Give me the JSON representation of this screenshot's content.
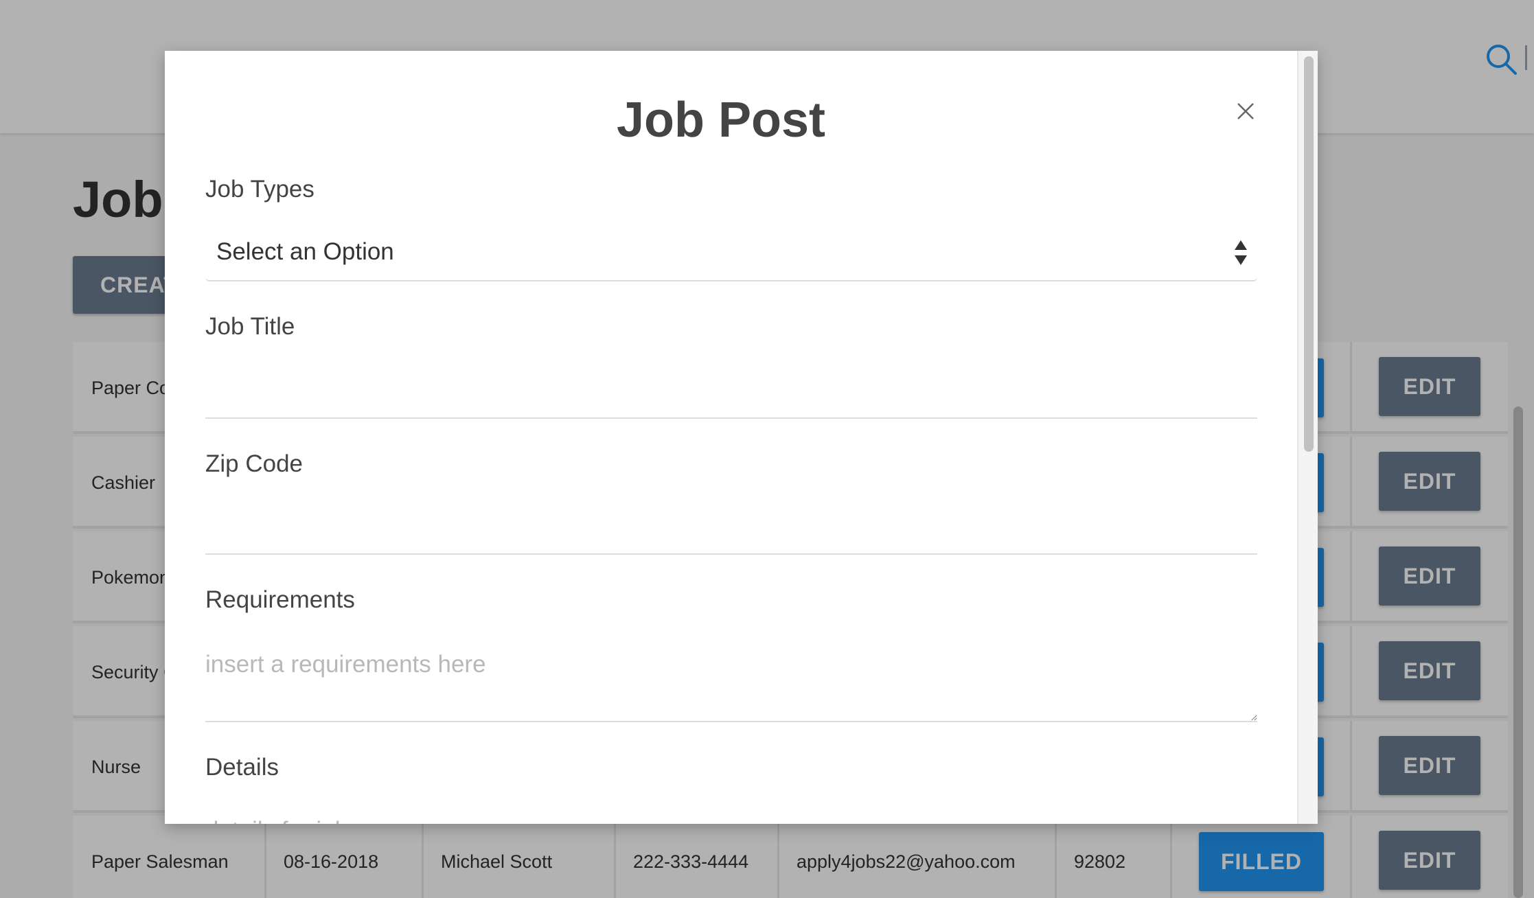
{
  "page": {
    "title": "Job",
    "create_button": "CREAT"
  },
  "table": {
    "rows": [
      {
        "title": "Paper Co",
        "status_label": "",
        "edit_label": "EDIT"
      },
      {
        "title": "Cashier",
        "status_label": "",
        "edit_label": "EDIT"
      },
      {
        "title": "Pokemon",
        "status_label": "",
        "edit_label": "EDIT"
      },
      {
        "title": "Security C",
        "status_label": "",
        "edit_label": "EDIT"
      },
      {
        "title": "Nurse",
        "status_label": "",
        "edit_label": "EDIT"
      },
      {
        "title": "Paper Salesman",
        "date": "08-16-2018",
        "contact": "Michael Scott",
        "phone": "222-333-4444",
        "email": "apply4jobs22@yahoo.com",
        "zip": "92802",
        "status_label": "FILLED",
        "edit_label": "EDIT"
      }
    ]
  },
  "modal": {
    "title": "Job Post",
    "job_types": {
      "label": "Job Types",
      "selected": "Select an Option"
    },
    "job_title": {
      "label": "Job Title",
      "value": "",
      "placeholder": ""
    },
    "zip_code": {
      "label": "Zip Code",
      "value": "",
      "placeholder": ""
    },
    "requirements": {
      "label": "Requirements",
      "placeholder": "insert a requirements here"
    },
    "details": {
      "label": "Details",
      "placeholder": "details for job"
    }
  },
  "colors": {
    "accent": "#2196f3",
    "secondary_button": "#6b7b8f",
    "overlay": "rgba(0,0,0,0.30)"
  },
  "icons": {
    "search": "search-icon",
    "close": "close-icon",
    "select_arrows": "select-arrows-icon"
  }
}
